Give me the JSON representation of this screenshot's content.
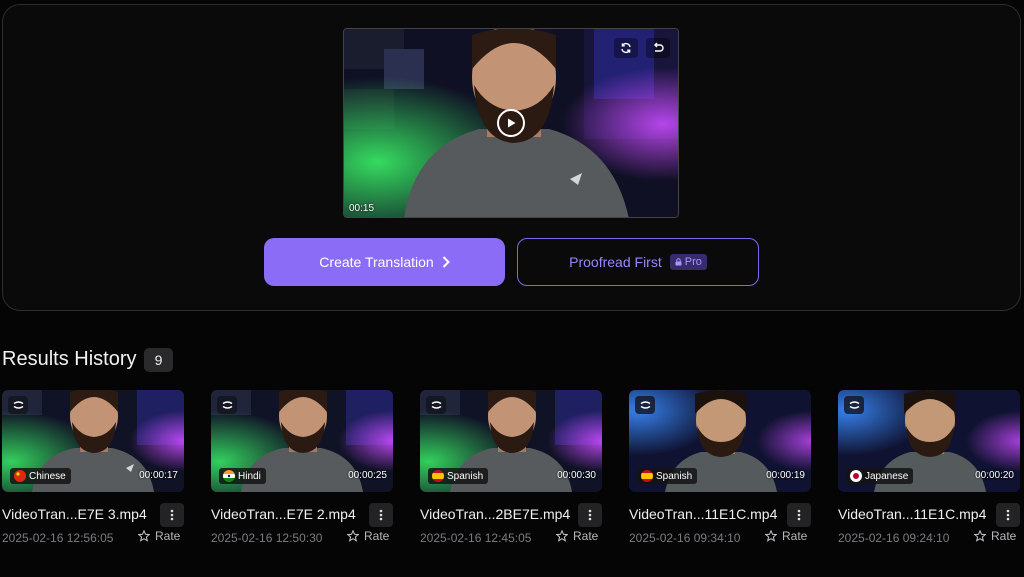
{
  "preview": {
    "time": "00:15",
    "icons": {
      "refresh": "refresh-icon",
      "undo": "undo-icon",
      "play": "play-icon"
    }
  },
  "actions": {
    "create_label": "Create Translation",
    "proofread_label": "Proofread First",
    "pro_label": "Pro"
  },
  "history": {
    "title": "Results History",
    "count": "9",
    "items": [
      {
        "name": "VideoTran...E7E 3.mp4",
        "language": "Chinese",
        "flag": "china-flag",
        "duration": "00:00:17",
        "date": "2025-02-16 12:56:05",
        "rate_label": "Rate"
      },
      {
        "name": "VideoTran...E7E 2.mp4",
        "language": "Hindi",
        "flag": "india-flag",
        "duration": "00:00:25",
        "date": "2025-02-16 12:50:30",
        "rate_label": "Rate"
      },
      {
        "name": "VideoTran...2BE7E.mp4",
        "language": "Spanish",
        "flag": "spain-flag",
        "duration": "00:00:30",
        "date": "2025-02-16 12:45:05",
        "rate_label": "Rate"
      },
      {
        "name": "VideoTran...11E1C.mp4",
        "language": "Spanish",
        "flag": "spain-flag",
        "duration": "00:00:19",
        "date": "2025-02-16 09:34:10",
        "rate_label": "Rate"
      },
      {
        "name": "VideoTran...11E1C.mp4",
        "language": "Japanese",
        "flag": "japan-flag",
        "duration": "00:00:20",
        "date": "2025-02-16 09:24:10",
        "rate_label": "Rate"
      }
    ]
  },
  "colors": {
    "accent": "#8b6cf6",
    "accent_border": "#8166ec",
    "background": "#050505",
    "panel_border": "#2d2d2f"
  }
}
